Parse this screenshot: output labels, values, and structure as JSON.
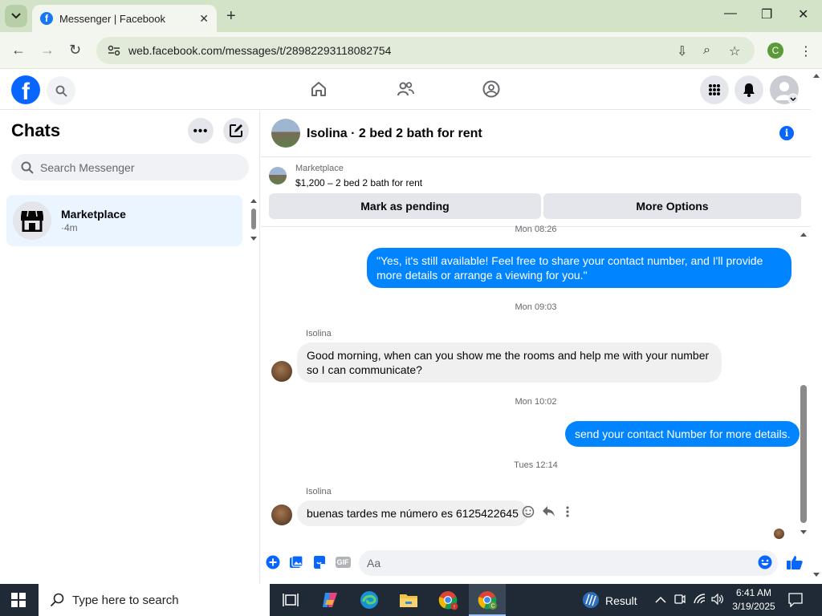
{
  "browser": {
    "tab_title": "Messenger | Facebook",
    "url": "web.facebook.com/messages/t/28982293118082754",
    "profile_initial": "C"
  },
  "fb": {
    "logo_letter": "f"
  },
  "sidebar": {
    "title": "Chats",
    "search_placeholder": "Search Messenger",
    "chats": [
      {
        "name": "Marketplace",
        "meta": "·4m"
      }
    ]
  },
  "conversation": {
    "title": "Isolina · 2 bed 2 bath for rent",
    "marketplace_label": "Marketplace",
    "listing": "$1,200 – 2 bed 2 bath for rent",
    "mark_pending_label": "Mark as pending",
    "more_options_label": "More Options",
    "messages": [
      {
        "type": "timestamp",
        "text": "Mon 08:26"
      },
      {
        "type": "out",
        "text": "\"Yes, it's still available! Feel free to share your contact number, and I'll provide more details or arrange a viewing for you.\""
      },
      {
        "type": "timestamp",
        "text": "Mon 09:03"
      },
      {
        "type": "in",
        "sender": "Isolina",
        "text": "Good morning, when can you show me the rooms and help me with your number so I can communicate?"
      },
      {
        "type": "timestamp",
        "text": "Mon 10:02"
      },
      {
        "type": "out",
        "text": "send your contact Number for more details."
      },
      {
        "type": "timestamp",
        "text": "Tues 12:14"
      },
      {
        "type": "in",
        "sender": "Isolina",
        "text": "buenas tardes me número es 6125422645"
      }
    ],
    "composer_placeholder": "Aa",
    "gif_label": "GIF"
  },
  "taskbar": {
    "search_placeholder": "Type here to search",
    "result_label": "Result",
    "time": "6:41 AM",
    "date": "3/19/2025"
  }
}
